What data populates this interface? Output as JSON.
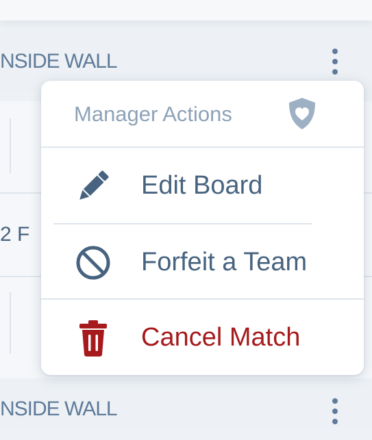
{
  "board": {
    "rows": [
      {
        "label": "NSIDE WALL"
      },
      {
        "text": "2  F"
      },
      {
        "label": "NSIDE WALL"
      }
    ]
  },
  "menu": {
    "title": "Manager Actions",
    "header_icon": "shield-heart-icon",
    "items": [
      {
        "label": "Edit Board",
        "icon": "pencil-icon",
        "color": "#47637f"
      },
      {
        "label": "Forfeit a Team",
        "icon": "ban-icon",
        "color": "#47637f"
      },
      {
        "label": "Cancel Match",
        "icon": "trash-icon",
        "color": "#a6191c"
      }
    ]
  },
  "colors": {
    "text_primary": "#47637f",
    "text_muted": "#8da2b8",
    "danger": "#a6191c",
    "background": "#eef2f6"
  }
}
